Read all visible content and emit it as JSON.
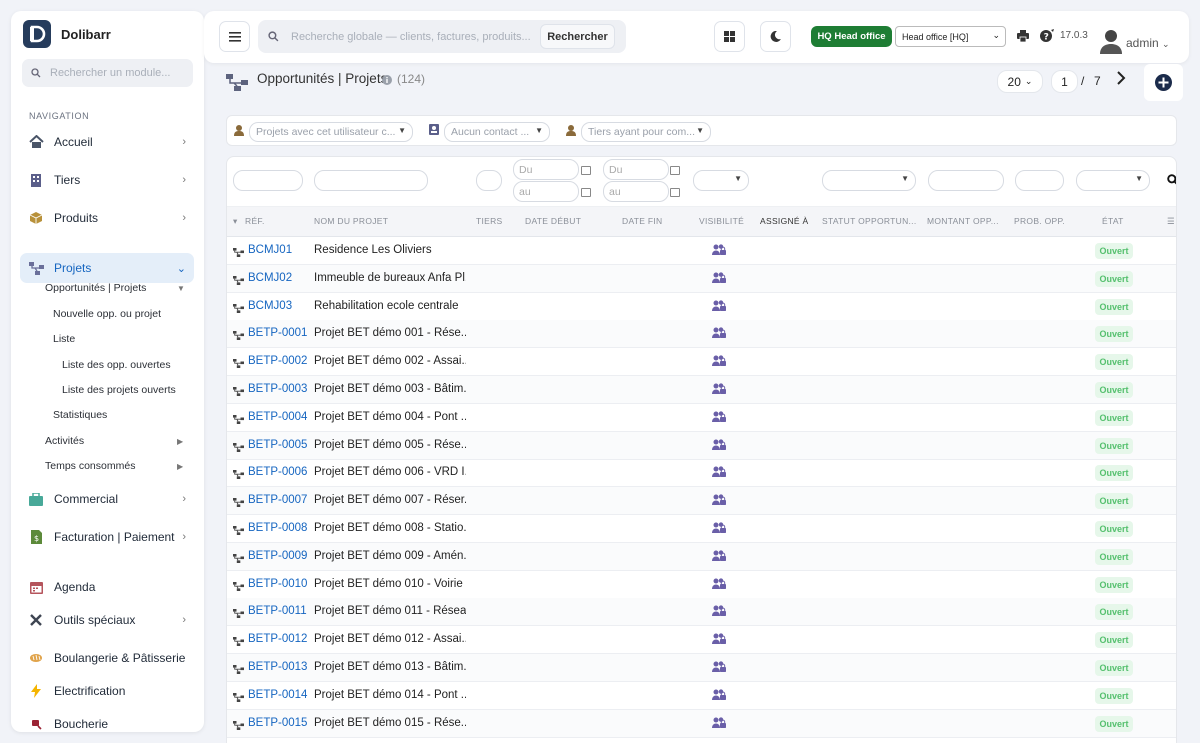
{
  "app": {
    "name": "Dolibarr",
    "module_search_placeholder": "Rechercher un module..."
  },
  "sidebar": {
    "section_title": "NAVIGATION",
    "items": [
      {
        "label": "Accueil",
        "icon": "home-icon"
      },
      {
        "label": "Tiers",
        "icon": "building-icon"
      },
      {
        "label": "Produits",
        "icon": "box-icon"
      },
      {
        "label": "Projets",
        "icon": "project-icon"
      },
      {
        "label": "Commercial",
        "icon": "briefcase-icon"
      },
      {
        "label": "Facturation | Paiement",
        "icon": "invoice-icon"
      },
      {
        "label": "Agenda",
        "icon": "calendar-icon"
      },
      {
        "label": "Outils spéciaux",
        "icon": "tools-icon"
      },
      {
        "label": "Boulangerie & Pâtisserie",
        "icon": "bread-icon"
      },
      {
        "label": "Electrification",
        "icon": "bolt-icon"
      },
      {
        "label": "Boucherie",
        "icon": "meat-icon"
      }
    ],
    "subitems": [
      {
        "label": "Opportunités | Projets"
      },
      {
        "label": "Nouvelle opp. ou projet"
      },
      {
        "label": "Liste"
      },
      {
        "label": "Liste des opp. ouvertes"
      },
      {
        "label": "Liste des projets ouverts"
      },
      {
        "label": "Statistiques"
      },
      {
        "label": "Activités"
      },
      {
        "label": "Temps consommés"
      }
    ]
  },
  "topbar": {
    "search_placeholder": "Recherche globale — clients, factures, produits...",
    "search_button": "Rechercher",
    "hq_badge": "HQ  Head office",
    "entity": "Head office [HQ]",
    "version": "17.0.3",
    "user": "admin"
  },
  "page": {
    "title": "Opportunités | Projets",
    "count": "(124)",
    "per_page": "20",
    "page": "1",
    "page_sep": "/",
    "total_pages": "7"
  },
  "filters": {
    "user_placeholder": "Projets avec cet utilisateur c...",
    "contact_placeholder": "Aucun contact ...",
    "thirdparty_placeholder": "Tiers ayant pour com..."
  },
  "search_row": {
    "du": "Du",
    "au": "au"
  },
  "columns": [
    "RÉF.",
    "NOM DU PROJET",
    "TIERS",
    "DATE DÉBUT",
    "DATE FIN",
    "VISIBILITÉ",
    "ASSIGNÉ À",
    "STATUT OPPORTUN...",
    "MONTANT OPP...",
    "PROB. OPP.",
    "ÉTAT"
  ],
  "rows": [
    {
      "ref": "BCMJ01",
      "name": "Residence Les Oliviers",
      "status": "Ouvert"
    },
    {
      "ref": "BCMJ02",
      "name": "Immeuble de bureaux Anfa Pl...",
      "status": "Ouvert"
    },
    {
      "ref": "BCMJ03",
      "name": "Rehabilitation ecole centrale",
      "status": "Ouvert"
    },
    {
      "ref": "BETP-0001",
      "name": "Projet BET démo 001 - Rése...",
      "status": "Ouvert"
    },
    {
      "ref": "BETP-0002",
      "name": "Projet BET démo 002 - Assai...",
      "status": "Ouvert"
    },
    {
      "ref": "BETP-0003",
      "name": "Projet BET démo 003 - Bâtim...",
      "status": "Ouvert"
    },
    {
      "ref": "BETP-0004",
      "name": "Projet BET démo 004 - Pont ...",
      "status": "Ouvert"
    },
    {
      "ref": "BETP-0005",
      "name": "Projet BET démo 005 - Rése...",
      "status": "Ouvert"
    },
    {
      "ref": "BETP-0006",
      "name": "Projet BET démo 006 - VRD I...",
      "status": "Ouvert"
    },
    {
      "ref": "BETP-0007",
      "name": "Projet BET démo 007 - Réser...",
      "status": "Ouvert"
    },
    {
      "ref": "BETP-0008",
      "name": "Projet BET démo 008 - Statio...",
      "status": "Ouvert"
    },
    {
      "ref": "BETP-0009",
      "name": "Projet BET démo 009 - Amén...",
      "status": "Ouvert"
    },
    {
      "ref": "BETP-0010",
      "name": "Projet BET démo 010 - Voirie ...",
      "status": "Ouvert"
    },
    {
      "ref": "BETP-0011",
      "name": "Projet BET démo 011 - Résea...",
      "status": "Ouvert"
    },
    {
      "ref": "BETP-0012",
      "name": "Projet BET démo 012 - Assai...",
      "status": "Ouvert"
    },
    {
      "ref": "BETP-0013",
      "name": "Projet BET démo 013 - Bâtim...",
      "status": "Ouvert"
    },
    {
      "ref": "BETP-0014",
      "name": "Projet BET démo 014 - Pont ...",
      "status": "Ouvert"
    },
    {
      "ref": "BETP-0015",
      "name": "Projet BET démo 015 - Rése...",
      "status": "Ouvert"
    }
  ],
  "colors": {
    "accent": "#1565c0",
    "hq": "#1e7d34",
    "status_green": "#55c06e",
    "logo": "#263c5c"
  }
}
